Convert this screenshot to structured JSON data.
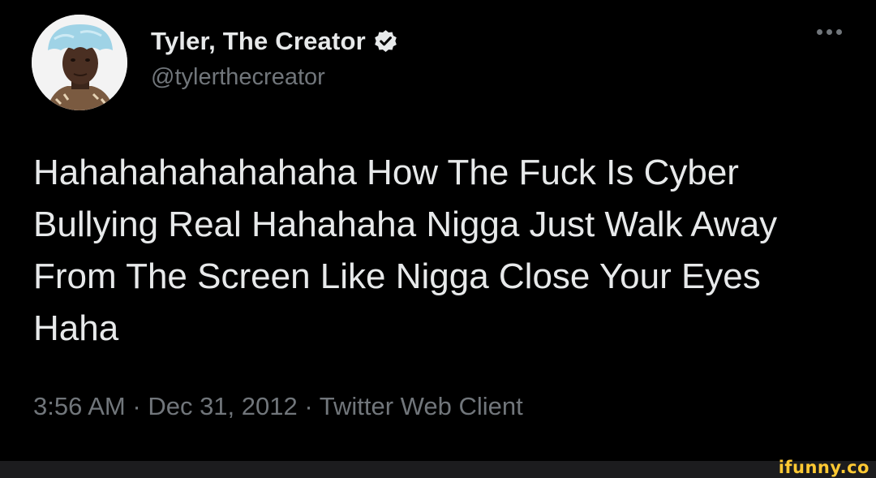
{
  "author": {
    "display_name": "Tyler, The Creator",
    "handle": "@tylerthecreator",
    "verified_icon": "verified-badge-icon"
  },
  "tweet": {
    "text": "Hahahahahahahaha How The Fuck Is Cyber Bullying Real Hahahaha Nigga Just Walk Away From The Screen Like Nigga Close Your Eyes Haha",
    "time": "3:56 AM",
    "date": "Dec 31, 2012",
    "source": "Twitter Web Client",
    "separator": "·"
  },
  "watermark": {
    "brand": "ifunny.co"
  },
  "colors": {
    "background": "#000000",
    "text_primary": "#e7e9ea",
    "text_secondary": "#71767b",
    "watermark": "#ffc933"
  }
}
